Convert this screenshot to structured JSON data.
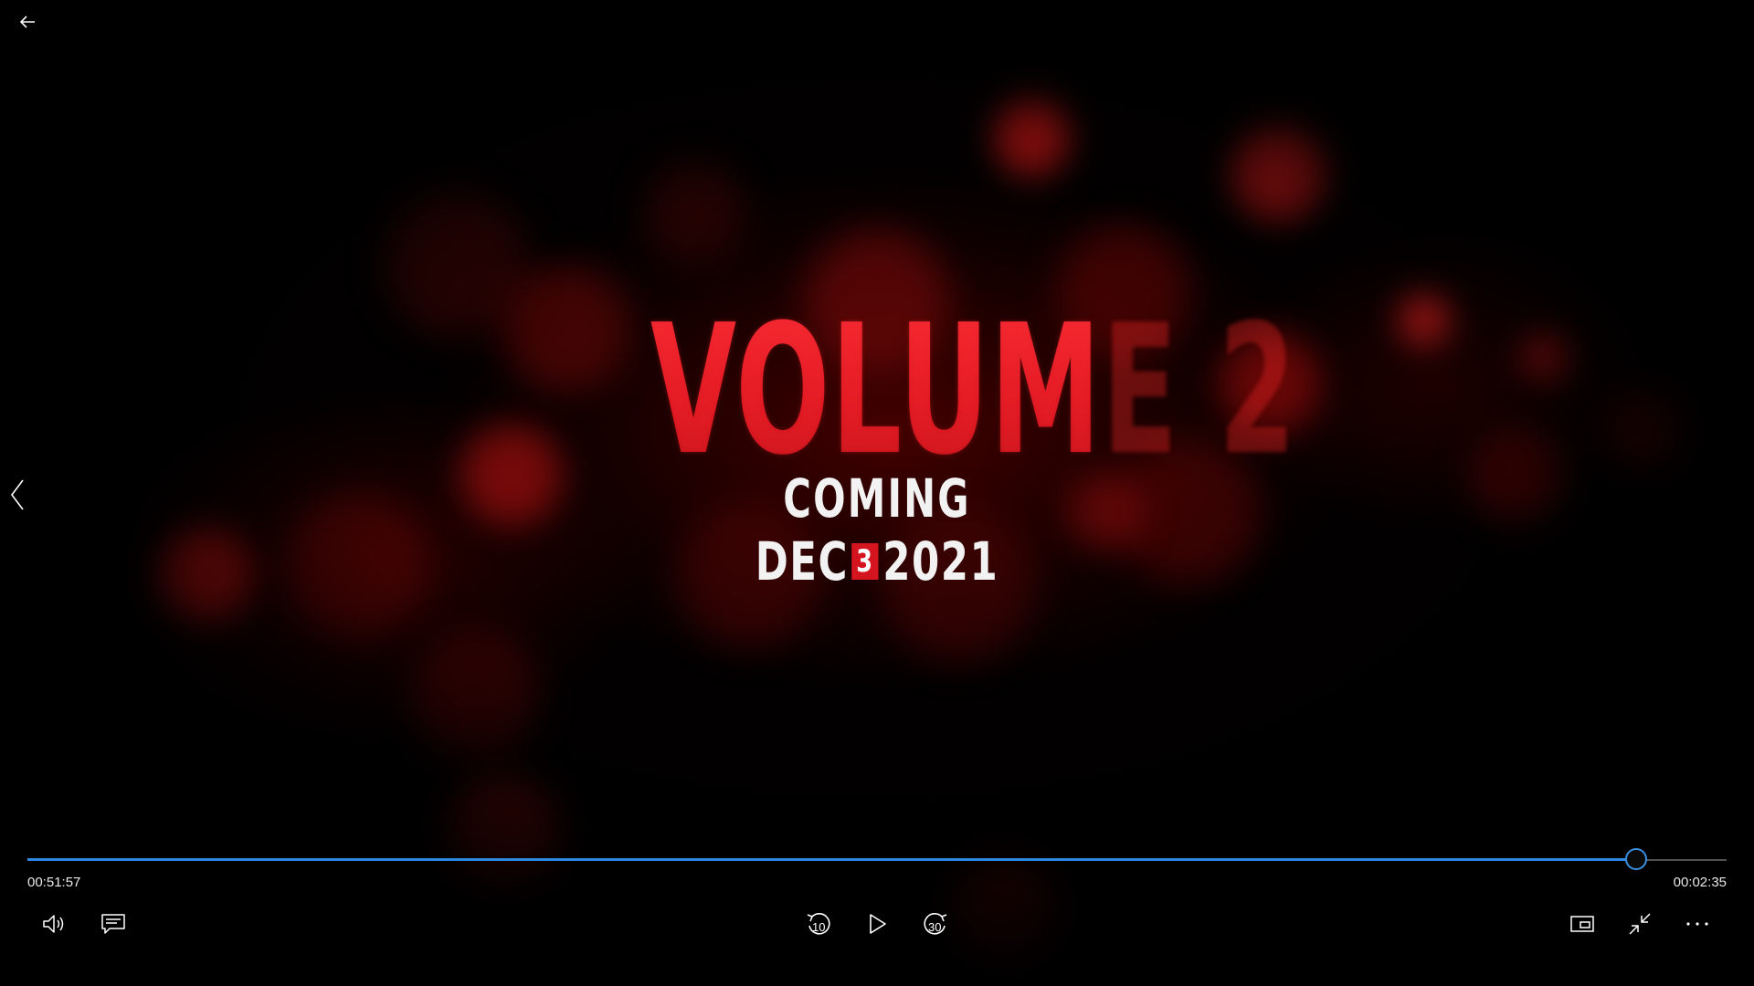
{
  "video": {
    "title_line": "VOLUME 2",
    "subtitle_line": "COMING",
    "date_month": "DEC",
    "date_day": "3",
    "date_year": "2021"
  },
  "player": {
    "elapsed_time": "00:51:57",
    "remaining_time": "00:02:35",
    "progress": 0.946,
    "accent_color": "#2b8ae0"
  },
  "icons": {
    "back": "back-arrow-icon",
    "previous": "chevron-left-icon",
    "volume": "volume-icon",
    "captions": "captions-icon",
    "skip_back": "skip-back-10-icon",
    "play": "play-icon",
    "skip_forward": "skip-forward-30-icon",
    "mini_view": "mini-view-icon",
    "exit_fullscreen": "exit-fullscreen-icon",
    "more": "more-options-icon"
  },
  "controls": {
    "skip_back_seconds": "10",
    "skip_forward_seconds": "30"
  }
}
